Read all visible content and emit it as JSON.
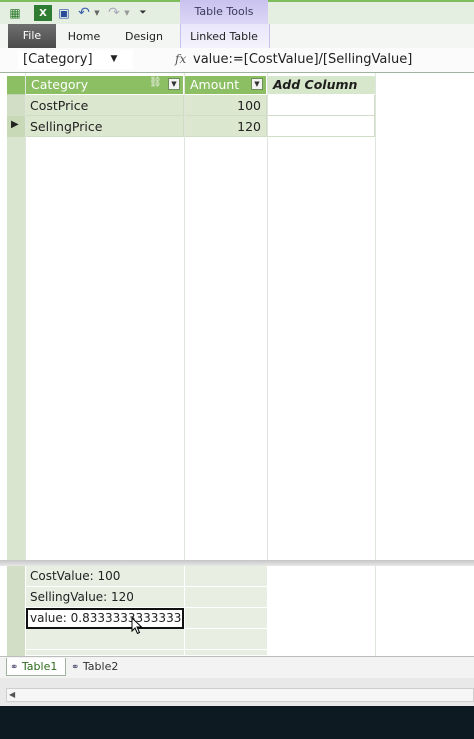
{
  "quick_access": {
    "icons": [
      "excel-icon",
      "save-icon",
      "undo-icon",
      "redo-icon",
      "customize-icon"
    ]
  },
  "ribbon": {
    "context_group": "Table Tools",
    "tabs": [
      "File",
      "Home",
      "Design",
      "Linked Table"
    ]
  },
  "formula_bar": {
    "name_box": "[Category]",
    "fx": "fx",
    "formula": "value:=[CostValue]/[SellingValue]"
  },
  "grid": {
    "columns": [
      {
        "label": "Category"
      },
      {
        "label": "Amount"
      },
      {
        "label": "Add Column"
      }
    ],
    "rows": [
      {
        "category": "CostPrice",
        "amount": "100"
      },
      {
        "category": "SellingPrice",
        "amount": "120"
      }
    ]
  },
  "measures": [
    "CostValue: 100",
    "SellingValue: 120",
    "value: 0.833333333333333..."
  ],
  "sheets": [
    "Table1",
    "Table2"
  ],
  "colors": {
    "header_green": "#8cbf63",
    "context_purple": "#c9c2ef",
    "selected_row": "#dce7d0"
  }
}
